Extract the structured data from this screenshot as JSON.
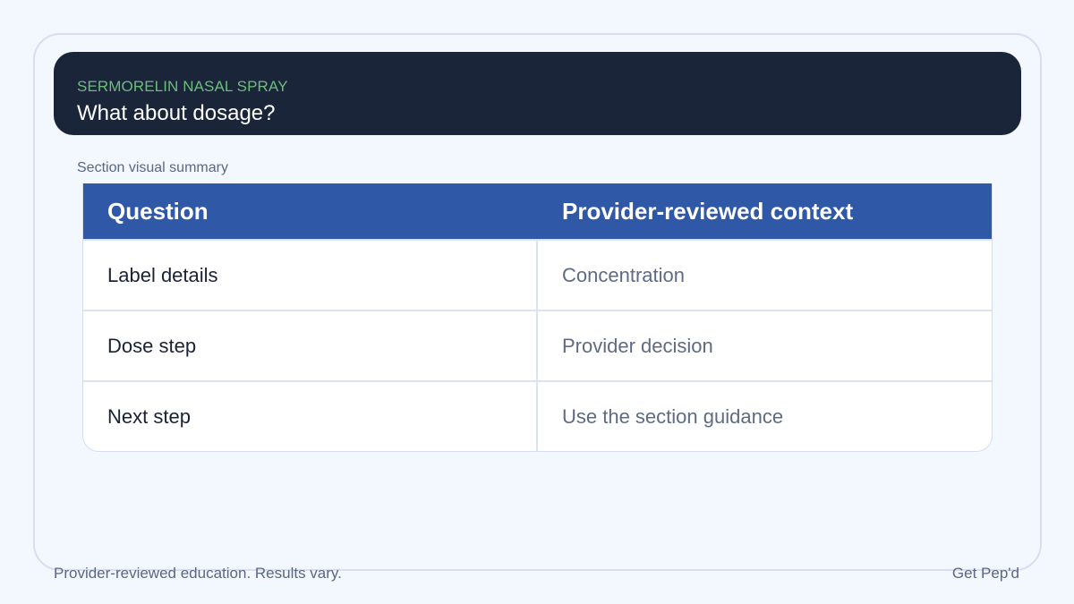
{
  "header": {
    "eyebrow": "SERMORELIN NASAL SPRAY",
    "title": "What about dosage?"
  },
  "summary_label": "Section visual summary",
  "table": {
    "columns": [
      "Question",
      "Provider-reviewed context"
    ],
    "rows": [
      [
        "Label details",
        "Concentration"
      ],
      [
        "Dose step",
        "Provider decision"
      ],
      [
        "Next step",
        "Use the section guidance"
      ]
    ]
  },
  "footer": {
    "disclaimer": "Provider-reviewed education. Results vary.",
    "brand": "Get Pep'd"
  },
  "colors": {
    "header_bg": "#1b253a",
    "eyebrow": "#6cbd7c",
    "table_header_bg": "#2f58a7",
    "page_bg": "#f3f7fe"
  }
}
